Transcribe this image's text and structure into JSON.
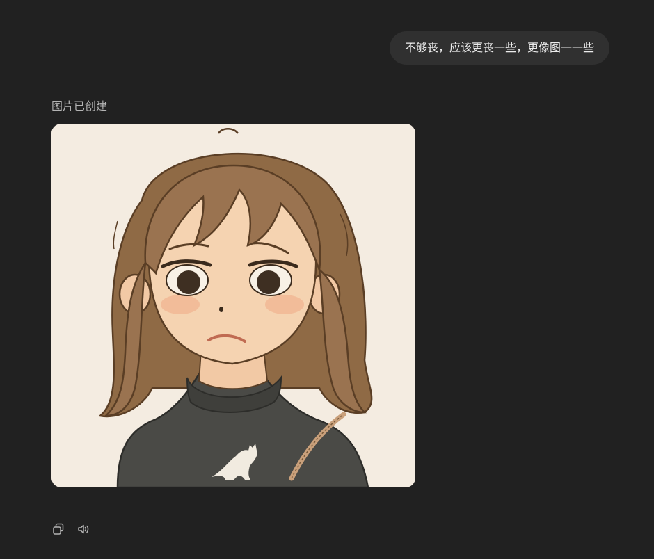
{
  "user_message": {
    "text": "不够丧，应该更丧一些，更像图一一些"
  },
  "assistant": {
    "status_label": "图片已创建"
  },
  "colors": {
    "background": "#212121",
    "bubble": "#303030",
    "text": "#ececec",
    "muted": "#b4b4b4"
  },
  "icons": [
    "copy-icon",
    "speaker-icon"
  ]
}
